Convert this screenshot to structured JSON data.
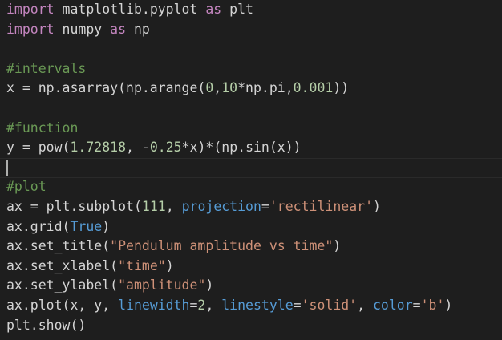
{
  "editor": {
    "lines": [
      [
        {
          "t": "import",
          "c": "kw"
        },
        {
          "t": " matplotlib.pyplot ",
          "c": "txt"
        },
        {
          "t": "as",
          "c": "kw"
        },
        {
          "t": " plt",
          "c": "txt"
        }
      ],
      [
        {
          "t": "import",
          "c": "kw"
        },
        {
          "t": " numpy ",
          "c": "txt"
        },
        {
          "t": "as",
          "c": "kw"
        },
        {
          "t": " np",
          "c": "txt"
        }
      ],
      [],
      [
        {
          "t": "#intervals",
          "c": "cm"
        }
      ],
      [
        {
          "t": "x = np.asarray(np.arange(",
          "c": "txt"
        },
        {
          "t": "0",
          "c": "num"
        },
        {
          "t": ",",
          "c": "txt"
        },
        {
          "t": "10",
          "c": "num"
        },
        {
          "t": "*np.pi,",
          "c": "txt"
        },
        {
          "t": "0.001",
          "c": "num"
        },
        {
          "t": "))",
          "c": "txt"
        }
      ],
      [],
      [
        {
          "t": "#function",
          "c": "cm"
        }
      ],
      [
        {
          "t": "y = pow(",
          "c": "txt"
        },
        {
          "t": "1.72818",
          "c": "num"
        },
        {
          "t": ", -",
          "c": "txt"
        },
        {
          "t": "0.25",
          "c": "num"
        },
        {
          "t": "*x)*(np.sin(x))",
          "c": "txt"
        }
      ],
      [],
      [
        {
          "t": "#plot",
          "c": "cm"
        }
      ],
      [
        {
          "t": "ax = plt.subplot(",
          "c": "txt"
        },
        {
          "t": "111",
          "c": "num"
        },
        {
          "t": ", ",
          "c": "txt"
        },
        {
          "t": "projection",
          "c": "param"
        },
        {
          "t": "=",
          "c": "txt"
        },
        {
          "t": "'rectilinear'",
          "c": "str"
        },
        {
          "t": ")",
          "c": "txt"
        }
      ],
      [
        {
          "t": "ax.grid(",
          "c": "txt"
        },
        {
          "t": "True",
          "c": "param"
        },
        {
          "t": ")",
          "c": "txt"
        }
      ],
      [
        {
          "t": "ax.set_title(",
          "c": "txt"
        },
        {
          "t": "\"Pendulum amplitude vs time\"",
          "c": "str"
        },
        {
          "t": ")",
          "c": "txt"
        }
      ],
      [
        {
          "t": "ax.set_xlabel(",
          "c": "txt"
        },
        {
          "t": "\"time\"",
          "c": "str"
        },
        {
          "t": ")",
          "c": "txt"
        }
      ],
      [
        {
          "t": "ax.set_ylabel(",
          "c": "txt"
        },
        {
          "t": "\"amplitude\"",
          "c": "str"
        },
        {
          "t": ")",
          "c": "txt"
        }
      ],
      [
        {
          "t": "ax.plot(x, y, ",
          "c": "txt"
        },
        {
          "t": "linewidth",
          "c": "param"
        },
        {
          "t": "=",
          "c": "txt"
        },
        {
          "t": "2",
          "c": "num"
        },
        {
          "t": ", ",
          "c": "txt"
        },
        {
          "t": "linestyle",
          "c": "param"
        },
        {
          "t": "=",
          "c": "txt"
        },
        {
          "t": "'solid'",
          "c": "str"
        },
        {
          "t": ", ",
          "c": "txt"
        },
        {
          "t": "color",
          "c": "param"
        },
        {
          "t": "=",
          "c": "txt"
        },
        {
          "t": "'b'",
          "c": "str"
        },
        {
          "t": ")",
          "c": "txt"
        }
      ],
      [
        {
          "t": "plt.show()",
          "c": "txt"
        }
      ]
    ]
  },
  "colors": {
    "background": "#1e1e1e",
    "keyword": "#c586c0",
    "comment": "#6a9955",
    "number": "#b5cea8",
    "string": "#ce9178",
    "parameter": "#569cd6",
    "text": "#d4d4d4"
  }
}
